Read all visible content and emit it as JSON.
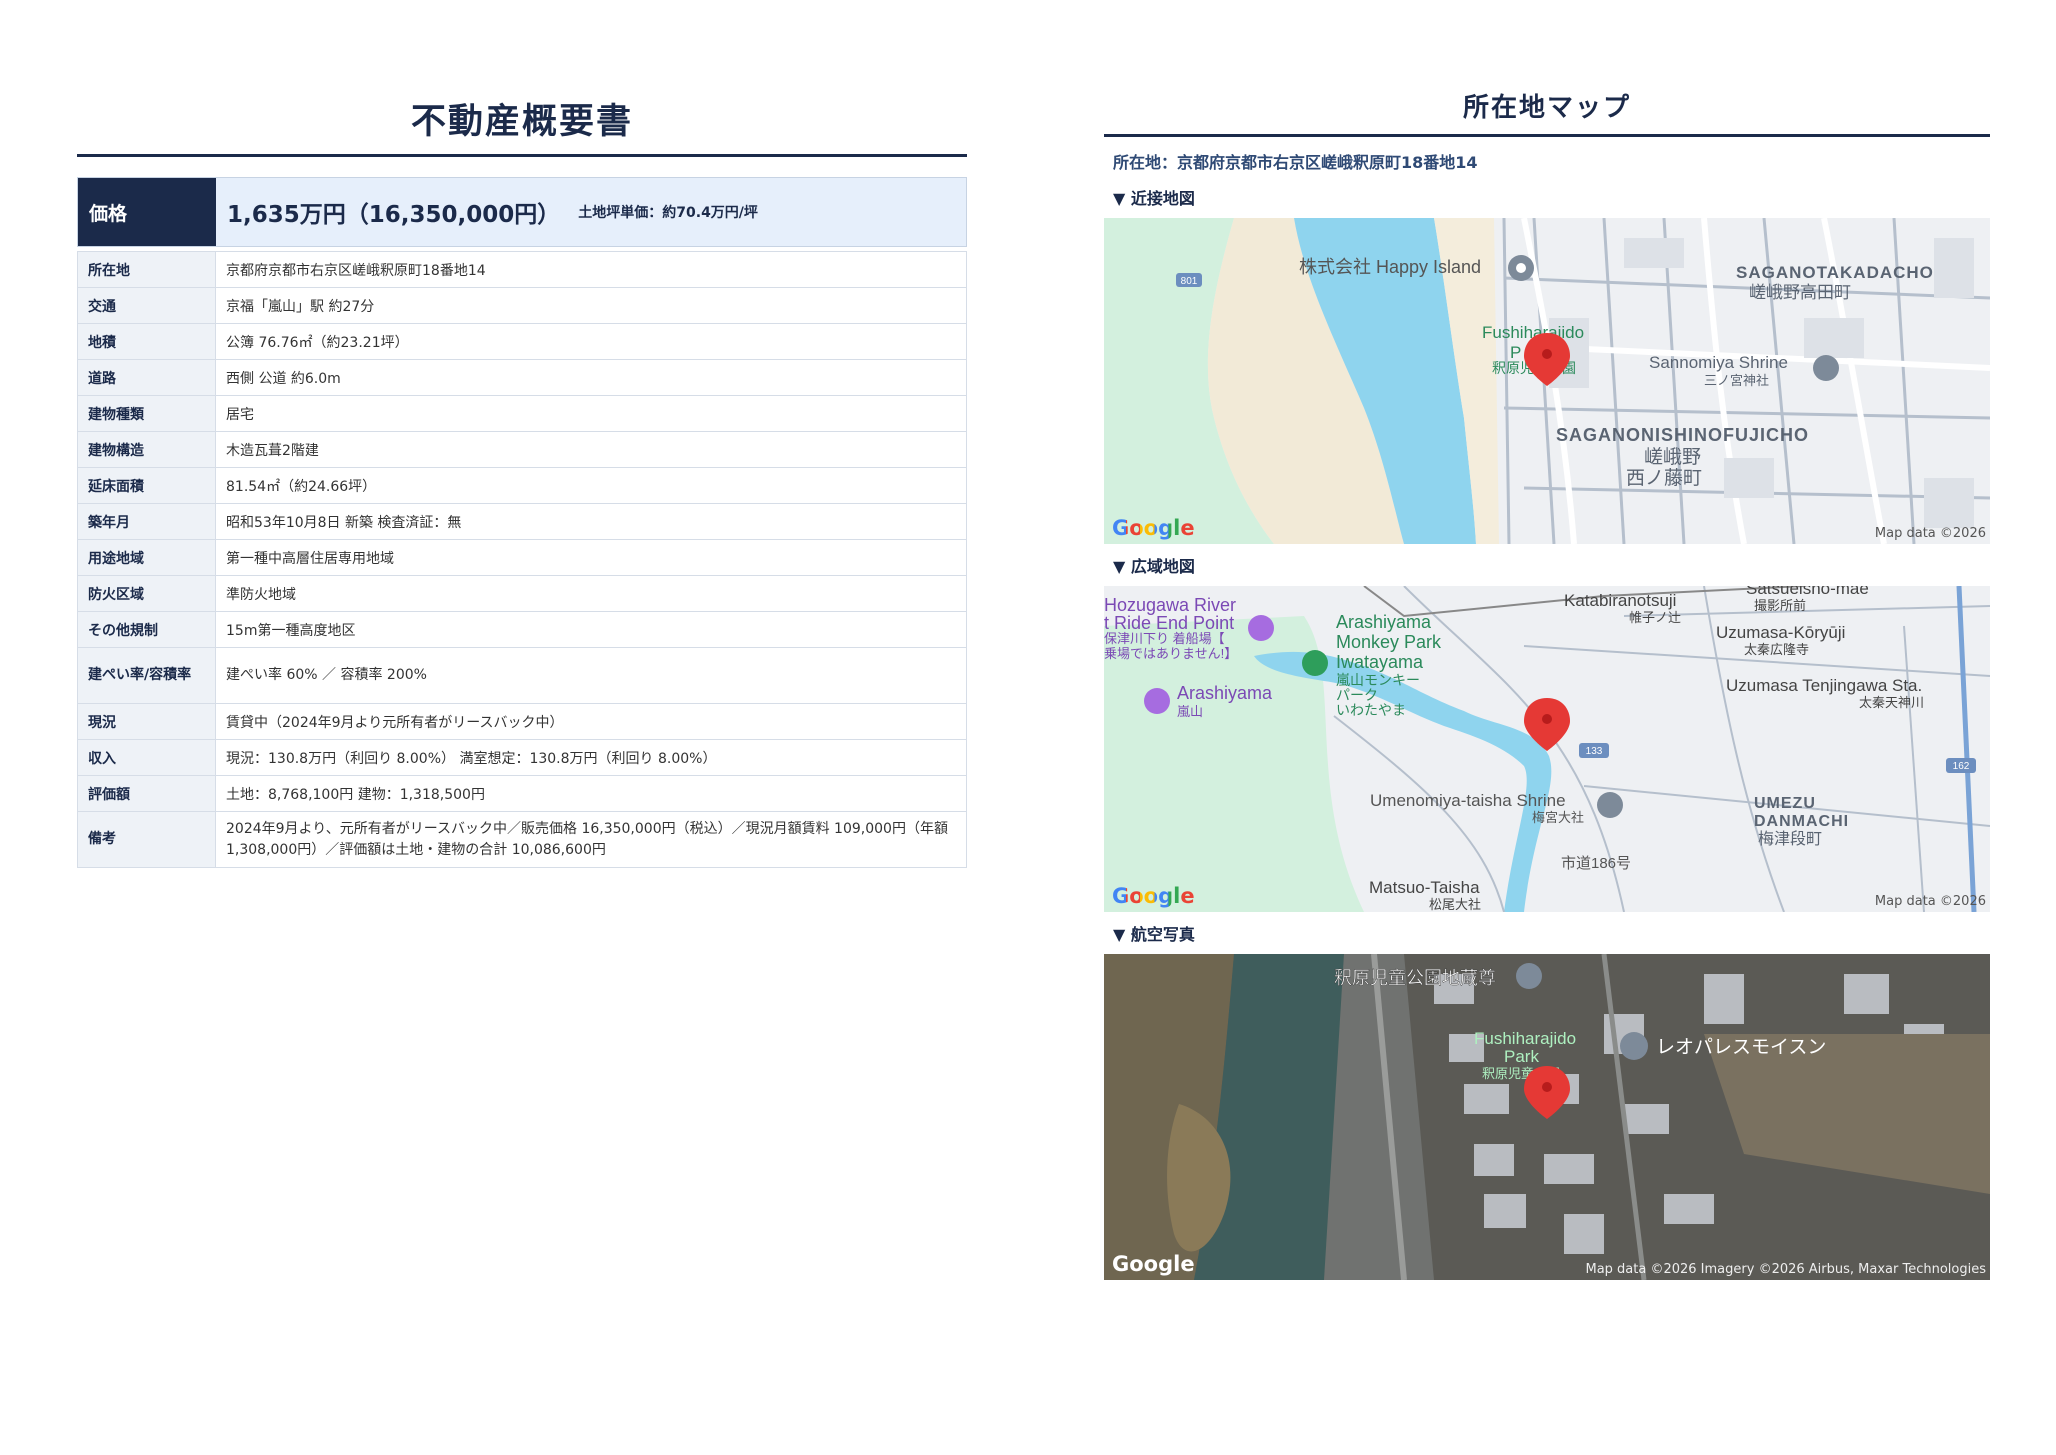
{
  "doc": {
    "title": "不動産概要書",
    "price_label": "価格",
    "price_value": "1,635万円（16,350,000円）",
    "price_unit": "土地坪単価：約70.4万円/坪",
    "rows": [
      {
        "k": "所在地",
        "v": "京都府京都市右京区嵯峨釈原町18番地14"
      },
      {
        "k": "交通",
        "v": "京福「嵐山」駅 約27分"
      },
      {
        "k": "地積",
        "v": "公簿 76.76㎡（約23.21坪）"
      },
      {
        "k": "道路",
        "v": "西側 公道 約6.0m"
      },
      {
        "k": "建物種類",
        "v": "居宅"
      },
      {
        "k": "建物構造",
        "v": "木造瓦葺2階建"
      },
      {
        "k": "延床面積",
        "v": "81.54㎡（約24.66坪）"
      },
      {
        "k": "築年月",
        "v": "昭和53年10月8日 新築 検査済証：無"
      },
      {
        "k": "用途地域",
        "v": "第一種中高層住居専用地域"
      },
      {
        "k": "防火区域",
        "v": "準防火地域"
      },
      {
        "k": "その他規制",
        "v": "15m第一種高度地区"
      },
      {
        "k": "建ぺい率/容積率",
        "v": "建ぺい率 60% ／ 容積率 200%"
      },
      {
        "k": "現況",
        "v": "賃貸中（2024年9月より元所有者がリースバック中）"
      },
      {
        "k": "収入",
        "v": "現況：130.8万円（利回り 8.00%） 満室想定：130.8万円（利回り 8.00%）"
      },
      {
        "k": "評価額",
        "v": "土地：8,768,100円 建物：1,318,500円"
      },
      {
        "k": "備考",
        "v": "2024年9月より、元所有者がリースバック中／販売価格 16,350,000円（税込）／現況月額賃料 109,000円（年額1,308,000円）／評価額は土地・建物の合計 10,086,600円"
      }
    ]
  },
  "maps": {
    "title": "所在地マップ",
    "address": "所在地：京都府京都市右京区嵯峨釈原町18番地14",
    "google": "Google",
    "near": {
      "label": "▼ 近接地図",
      "credit": "Map data ©2026",
      "labels": {
        "happy": "株式会社 Happy Island",
        "fushi1": "Fushiharajido",
        "fushi2": "P",
        "fushi_jp": "釈原児童公園",
        "sagano_taka": "SAGANOTAKADACHO",
        "sagano_taka_jp": "嵯峨野高田町",
        "sannomiya": "Sannomiya Shrine",
        "sannomiya_jp": "三ノ宮神社",
        "saganishi": "SAGANONISHINOFUJICHO",
        "saganishi_jp1": "嵯峨野",
        "saganishi_jp2": "西ノ藤町",
        "road": "801"
      }
    },
    "wide": {
      "label": "▼ 広域地図",
      "credit": "Map data ©2026",
      "labels": {
        "hozu1": "Hozugawa River",
        "hozu2": "t Ride End Point",
        "hozu_jp1": "保津川下り 着船場【",
        "hozu_jp2": "乗場ではありません!】",
        "monkey1": "Arashiyama",
        "monkey2": "Monkey Park",
        "monkey3": "Iwatayama",
        "monkey_jp1": "嵐山モンキー",
        "monkey_jp2": "パーク",
        "monkey_jp3": "いわたやま",
        "arashiyama": "Arashiyama",
        "arashiyama_jp": "嵐山",
        "katabira": "Katabiranotsuji",
        "katabira_jp": "帷子ノ辻",
        "satsu": "Satsueisho-mae",
        "satsu_jp": "撮影所前",
        "uzumasa": "Uzumasa-Kōryūji",
        "uzumasa_jp": "太秦広隆寺",
        "tenjin": "Uzumasa Tenjingawa Sta.",
        "tenjin_jp": "太秦天神川",
        "umenomiya": "Umenomiya-taisha Shrine",
        "umenomiya_jp": "梅宮大社",
        "umezu1": "UMEZU",
        "umezu2": "DANMACHI",
        "umezu_jp": "梅津段町",
        "matsuo": "Matsuo-Taisha",
        "matsuo_jp": "松尾大社",
        "city_road": "市道186号",
        "r133": "133",
        "r162": "162"
      }
    },
    "aerial": {
      "label": "▼ 航空写真",
      "credit": "Map data ©2026 Imagery ©2026 Airbus, Maxar Technologies",
      "labels": {
        "jizo": "釈原児童公園地蔵尊",
        "fushi1": "Fushiharajido",
        "fushi2": "Park",
        "fushi_jp": "釈原児童公園",
        "leo": "レオパレスモイスン"
      }
    }
  }
}
